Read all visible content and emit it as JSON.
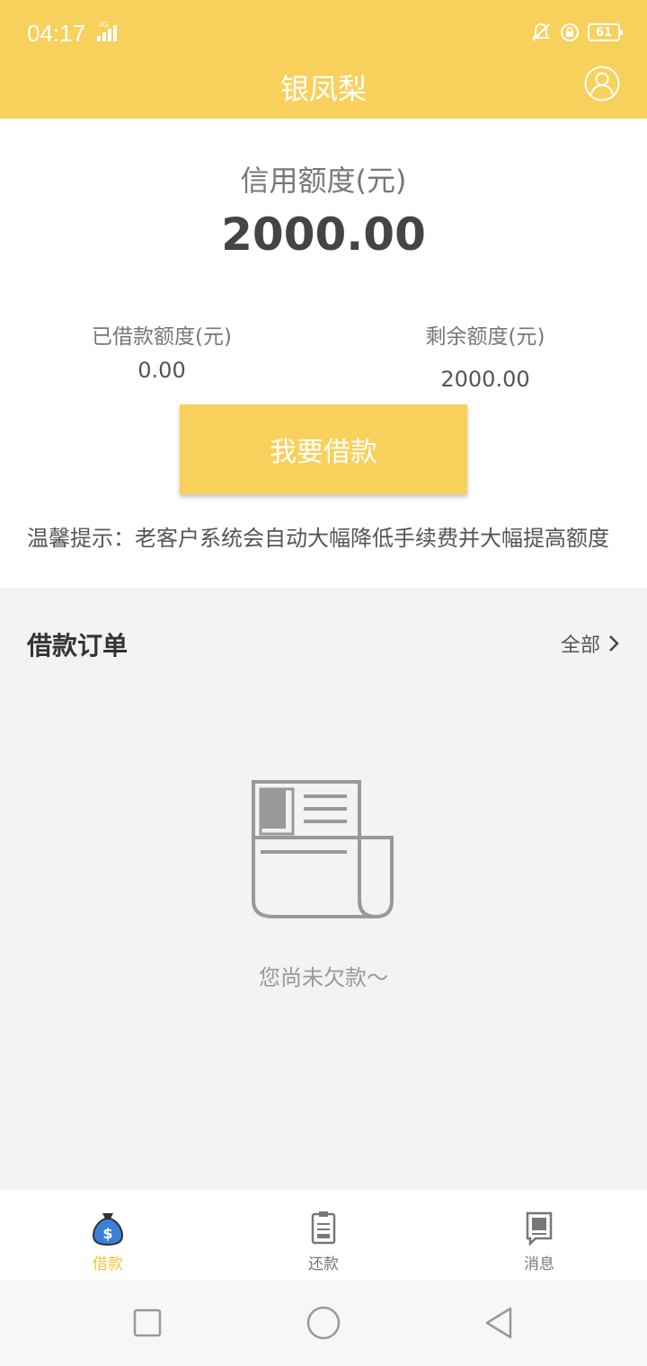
{
  "status_bar": {
    "time": "04:17",
    "network": "4G",
    "battery": "61"
  },
  "header": {
    "title": "银凤梨",
    "profile_icon": "user-avatar-icon"
  },
  "credit": {
    "label": "信用额度(元)",
    "amount": "2000.00",
    "borrowed_label": "已借款额度(元)",
    "borrowed_value": "0.00",
    "remaining_label": "剩余额度(元)",
    "remaining_value": "2000.00"
  },
  "borrow_button": "我要借款",
  "tip": "温馨提示：老客户系统会自动大幅降低手续费并大幅提高额度",
  "orders": {
    "title": "借款订单",
    "all_label": "全部",
    "empty_text": "您尚未欠款～"
  },
  "tabbar": {
    "items": [
      {
        "label": "借款",
        "icon": "money-bag-icon",
        "active": true
      },
      {
        "label": "还款",
        "icon": "clipboard-icon",
        "active": false
      },
      {
        "label": "消息",
        "icon": "message-icon",
        "active": false
      }
    ]
  },
  "colors": {
    "brand": "#f8d05c",
    "active_tab": "#f0c53e",
    "background": "#f2f3f3"
  }
}
